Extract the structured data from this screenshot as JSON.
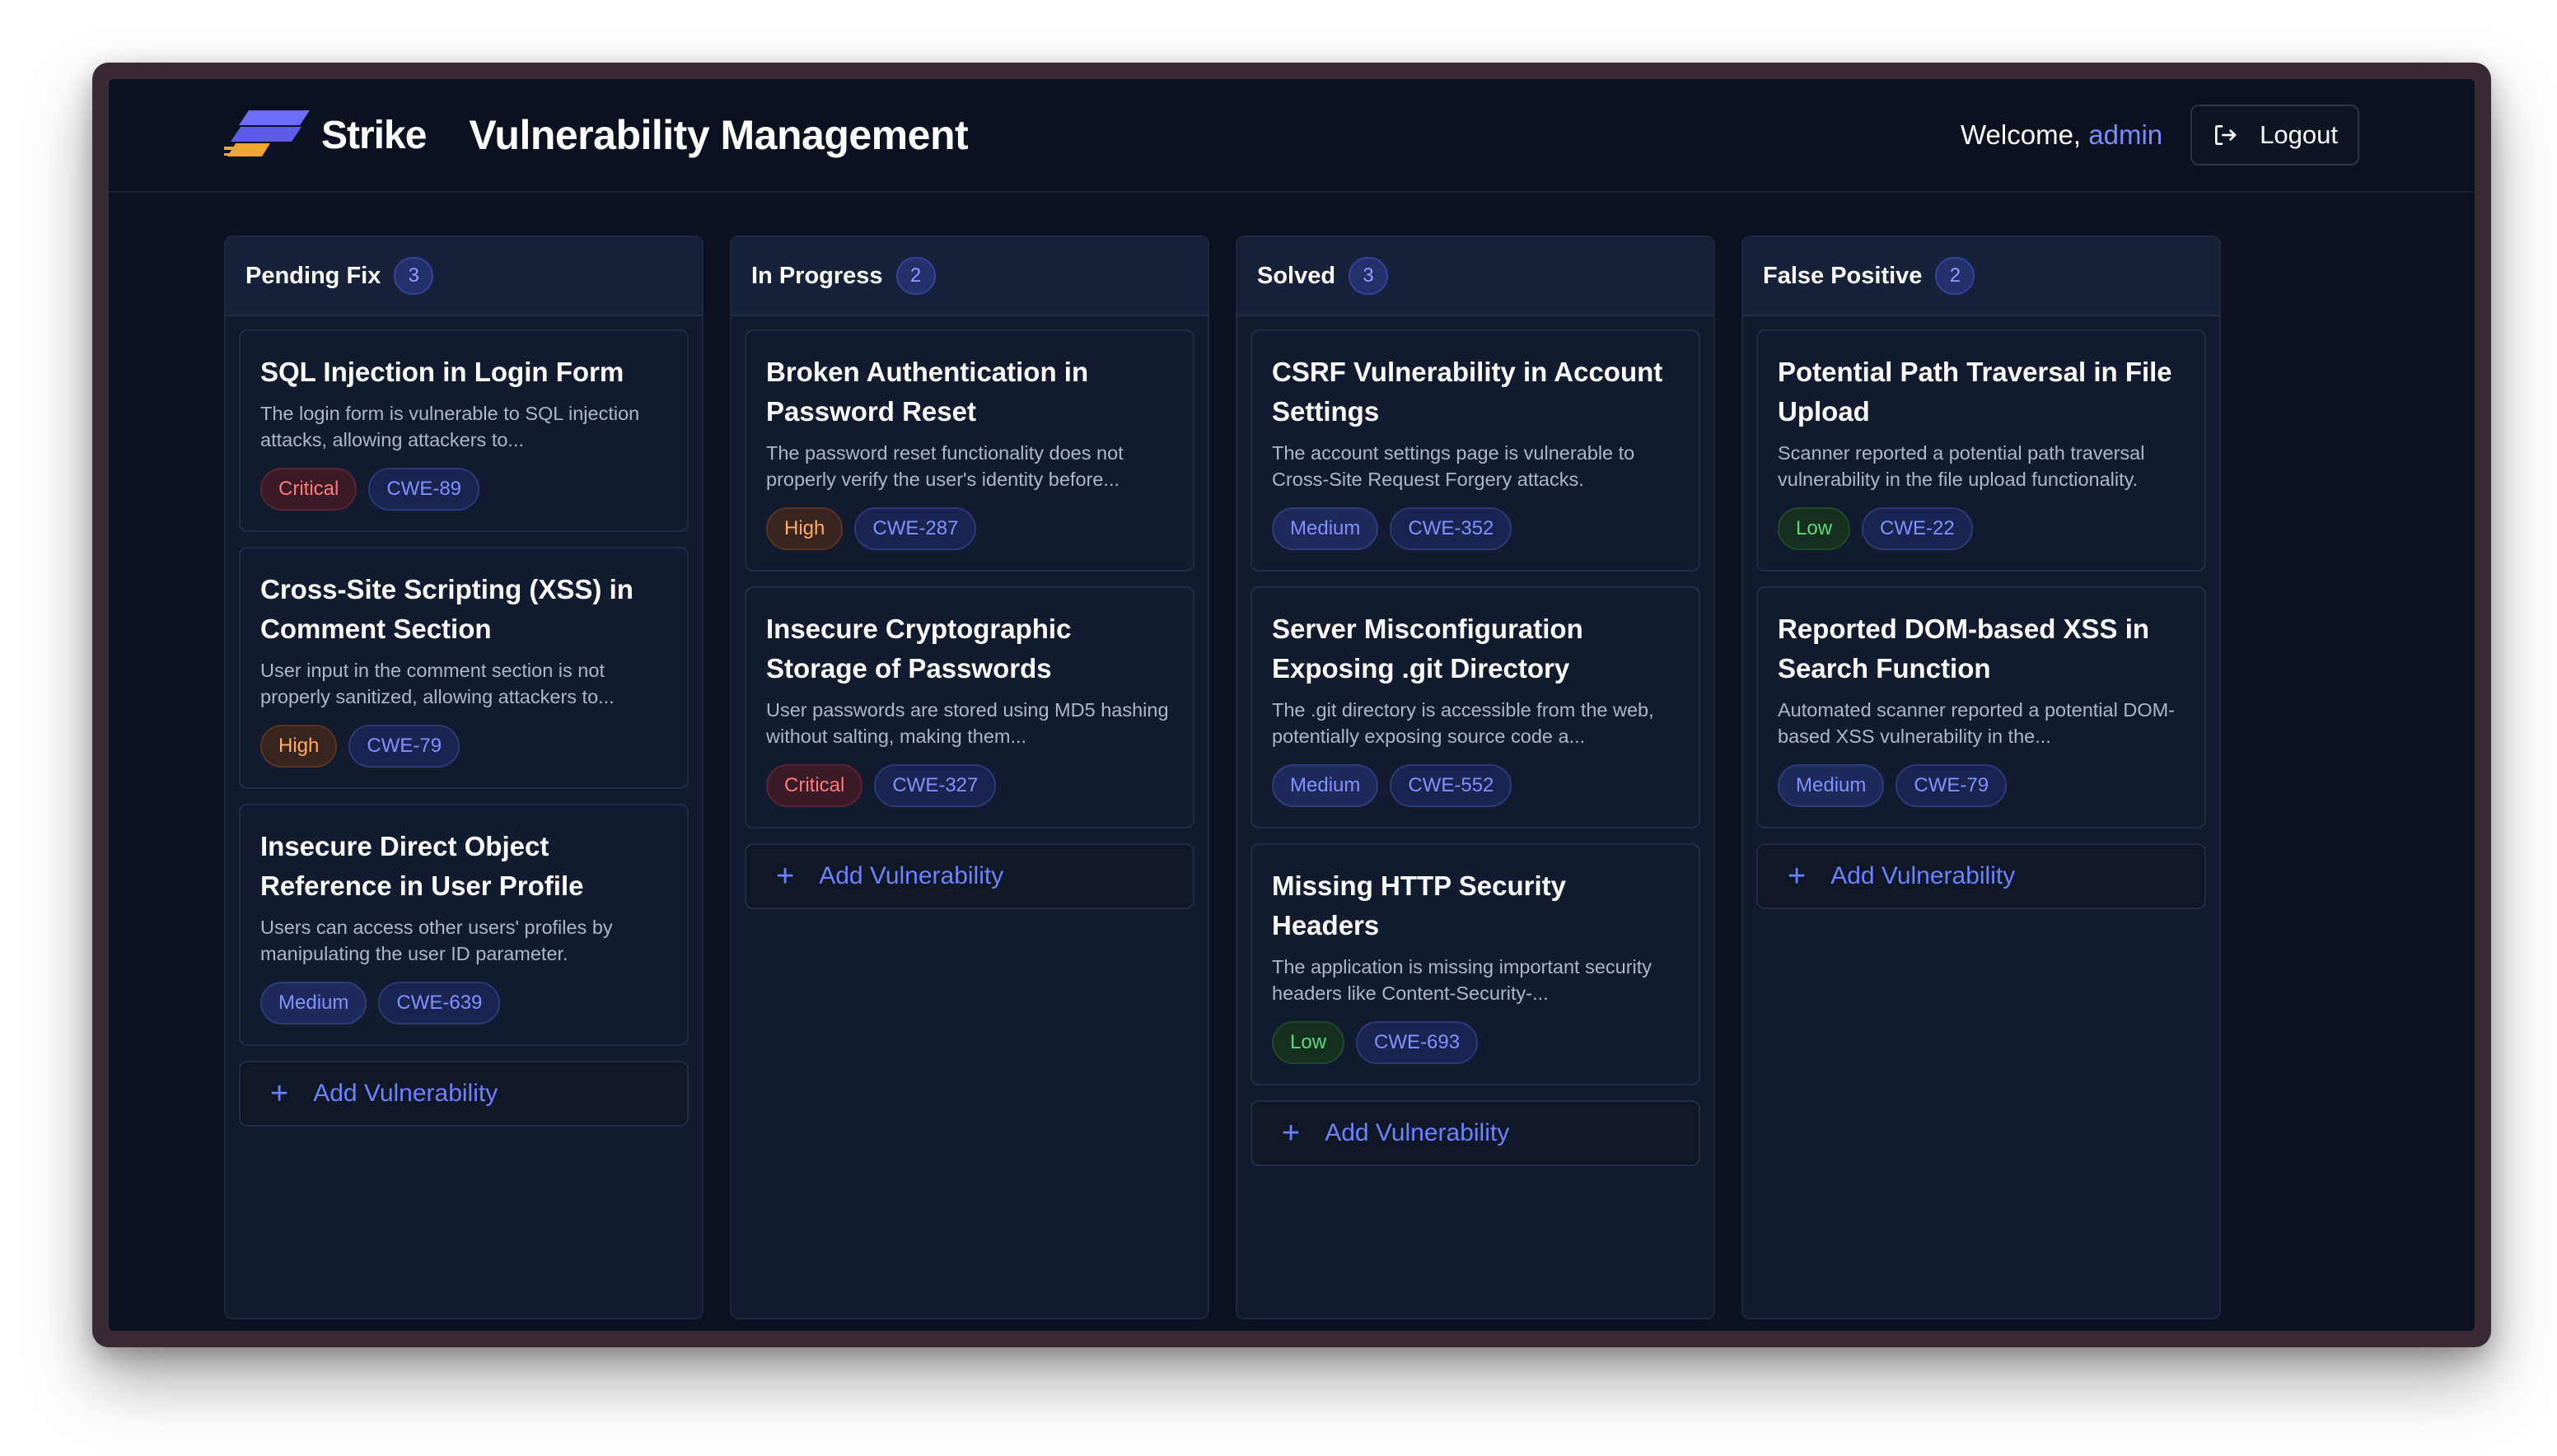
{
  "header": {
    "logo_text": "Strike",
    "title": "Vulnerability Management",
    "welcome_prefix": "Welcome,",
    "username": "admin",
    "logout_label": "Logout",
    "logout_icon": "logout-icon"
  },
  "colors": {
    "background": "#0c1222",
    "accent": "#6d82ff",
    "critical": "#ff7a7a",
    "high": "#ffad5c",
    "medium": "#7f93ff",
    "low": "#5fd67d"
  },
  "columns": [
    {
      "title": "Pending Fix",
      "count": "3",
      "add_label": "Add Vulnerability",
      "cards": [
        {
          "title": "SQL Injection in Login Form",
          "desc": "The login form is vulnerable to SQL injection attacks, allowing attackers to...",
          "severity": "Critical",
          "cwe": "CWE-89"
        },
        {
          "title": "Cross-Site Scripting (XSS) in Comment Section",
          "desc": "User input in the comment section is not properly sanitized, allowing attackers to...",
          "severity": "High",
          "cwe": "CWE-79"
        },
        {
          "title": "Insecure Direct Object Reference in User Profile",
          "desc": "Users can access other users' profiles by manipulating the user ID parameter.",
          "severity": "Medium",
          "cwe": "CWE-639"
        }
      ]
    },
    {
      "title": "In Progress",
      "count": "2",
      "add_label": "Add Vulnerability",
      "cards": [
        {
          "title": "Broken Authentication in Password Reset",
          "desc": "The password reset functionality does not properly verify the user's identity before...",
          "severity": "High",
          "cwe": "CWE-287"
        },
        {
          "title": "Insecure Cryptographic Storage of Passwords",
          "desc": "User passwords are stored using MD5 hashing without salting, making them...",
          "severity": "Critical",
          "cwe": "CWE-327"
        }
      ]
    },
    {
      "title": "Solved",
      "count": "3",
      "add_label": "Add Vulnerability",
      "cards": [
        {
          "title": "CSRF Vulnerability in Account Settings",
          "desc": "The account settings page is vulnerable to Cross-Site Request Forgery attacks.",
          "severity": "Medium",
          "cwe": "CWE-352"
        },
        {
          "title": "Server Misconfiguration Exposing .git Directory",
          "desc": "The .git directory is accessible from the web, potentially exposing source code a...",
          "severity": "Medium",
          "cwe": "CWE-552"
        },
        {
          "title": "Missing HTTP Security Headers",
          "desc": "The application is missing important security headers like Content-Security-...",
          "severity": "Low",
          "cwe": "CWE-693"
        }
      ]
    },
    {
      "title": "False Positive",
      "count": "2",
      "add_label": "Add Vulnerability",
      "cards": [
        {
          "title": "Potential Path Traversal in File Upload",
          "desc": "Scanner reported a potential path traversal vulnerability in the file upload functionality.",
          "severity": "Low",
          "cwe": "CWE-22"
        },
        {
          "title": "Reported DOM-based XSS in Search Function",
          "desc": "Automated scanner reported a potential DOM-based XSS vulnerability in the...",
          "severity": "Medium",
          "cwe": "CWE-79"
        }
      ]
    }
  ]
}
